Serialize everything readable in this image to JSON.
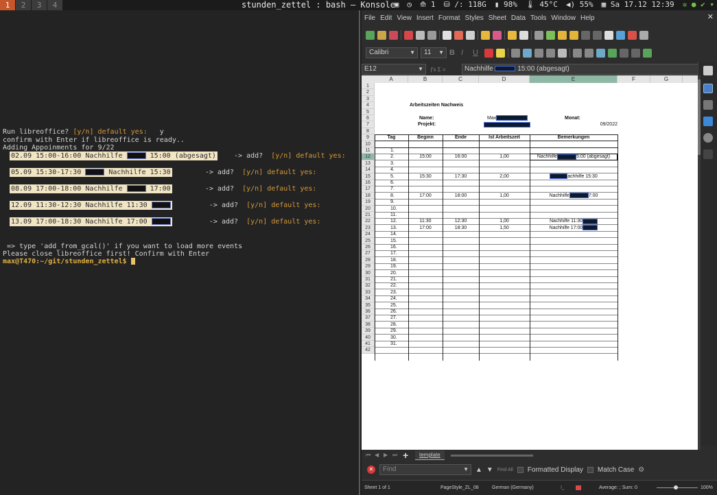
{
  "topbar": {
    "workspaces": [
      "1",
      "2",
      "3",
      "4"
    ],
    "window_title": "stunden_zettel : bash — Konsole",
    "status": {
      "updates": "1",
      "disk": "/: 118G",
      "battery": "98%",
      "temp": "45°C",
      "volume": "55%",
      "datetime": "Sa 17.12 12:39"
    }
  },
  "terminal": {
    "line_run": "Run libreoffice? ",
    "line_run_prompt": "[y/n] default yes:",
    "line_run_answer": "   y",
    "line_confirm": "confirm with Enter if libreoffice is ready..",
    "line_adding": "Adding Appoinments for 9/22",
    "appointments": [
      {
        "pre": "02.09 15:00-16:00 Nachhilfe ",
        "post": " 15:00 (abgesagt)",
        "add": "-> add?",
        "prompt": "[y/n] default yes:"
      },
      {
        "pre": "05.09 15:30-17:30 ",
        "post": " Nachhilfe 15:30",
        "add": "-> add?",
        "prompt": "[y/n] default yes:"
      },
      {
        "pre": "08.09 17:00-18:00 Nachhilfe ",
        "post": " 17:00",
        "add": "-> add?",
        "prompt": "[y/n] default yes:"
      },
      {
        "pre": "12.09 11:30-12:30 Nachhilfe 11:30 ",
        "post": "",
        "add": "-> add?",
        "prompt": "[y/n] default yes:"
      },
      {
        "pre": "13.09 17:00-18:30 Nachhilfe 17:00 ",
        "post": "",
        "add": "-> add?",
        "prompt": "[y/n] default yes:"
      }
    ],
    "line_hint": " => type 'add_from_gcal()' if you want to load more events",
    "line_close": "Please close libreoffice first! Confirm with Enter",
    "prompt_text": "max@T470",
    "prompt_path": ":~/git/stunden_zettel$ "
  },
  "libreoffice": {
    "menu": [
      "File",
      "Edit",
      "View",
      "Insert",
      "Format",
      "Styles",
      "Sheet",
      "Data",
      "Tools",
      "Window",
      "Help"
    ],
    "font_name": "Calibri",
    "font_size": "11",
    "name_box": "E12",
    "formula_icons": "ƒx Σ =",
    "formula_pre": "Nachhilfe ",
    "formula_post": " 15:00 (abgesagt)",
    "columns": [
      "A",
      "B",
      "C",
      "D",
      "E",
      "F",
      "G"
    ],
    "rows": [
      "1",
      "2",
      "3",
      "4",
      "5",
      "6",
      "7",
      "8",
      "9",
      "10",
      "11",
      "12",
      "13",
      "14",
      "15",
      "16",
      "17",
      "18",
      "19",
      "20",
      "21",
      "22",
      "23",
      "24",
      "25",
      "26",
      "27",
      "28",
      "29",
      "30",
      "31",
      "32",
      "33",
      "34",
      "35",
      "36",
      "37",
      "38",
      "39",
      "40",
      "41",
      "42"
    ],
    "sheet": {
      "title": "Arbeitszeiten Nachweis",
      "name_label": "Name:",
      "name_value": "Max",
      "project_label": "Projekt:",
      "month_label": "Monat:",
      "month_value": "09/2022",
      "headers": [
        "Tag",
        "Beginn",
        "Ende",
        "Ist Arbeitszeit",
        "Bemerkungen"
      ],
      "days": [
        "1.",
        "2.",
        "3.",
        "4.",
        "5.",
        "6.",
        "7.",
        "8.",
        "9.",
        "10.",
        "11.",
        "12.",
        "13.",
        "14.",
        "15.",
        "16.",
        "17.",
        "18.",
        "19.",
        "20.",
        "21.",
        "22.",
        "23.",
        "24.",
        "25.",
        "26.",
        "27.",
        "28.",
        "29.",
        "30.",
        "31."
      ],
      "entries": [
        {
          "day_index": 1,
          "begin": "15:00",
          "end": "16:00",
          "hours": "1,00",
          "remark_pre": "Nachhilfe",
          "remark_post": "5:00 (abgesagt)"
        },
        {
          "day_index": 4,
          "begin": "15:30",
          "end": "17:30",
          "hours": "2,00",
          "remark_pre": "",
          "remark_post": "achhilfe 15:30"
        },
        {
          "day_index": 7,
          "begin": "17:00",
          "end": "18:00",
          "hours": "1,00",
          "remark_pre": "Nachhilfe",
          "remark_post": "7:00"
        },
        {
          "day_index": 11,
          "begin": "11:30",
          "end": "12:30",
          "hours": "1,00",
          "remark_pre": "Nachhilfe 11:30",
          "remark_post": ""
        },
        {
          "day_index": 12,
          "begin": "17:00",
          "end": "18:30",
          "hours": "1,50",
          "remark_pre": "Nachhilfe 17:00",
          "remark_post": ""
        }
      ]
    },
    "sheet_tab": "template",
    "find_placeholder": "Find",
    "find_all": "Find All",
    "formatted_display": "Formatted Display",
    "match_case": "Match Case",
    "statusbar": {
      "sheet": "Sheet 1 of 1",
      "style": "PageStyle_ZL_08",
      "lang": "German (Germany)",
      "summary": "Average: ; Sum: 0",
      "zoom": "100%"
    }
  }
}
